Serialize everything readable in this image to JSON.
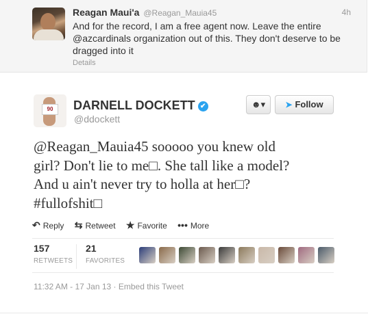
{
  "parent_tweet": {
    "name": "Reagan Maui'a",
    "handle": "@Reagan_Mauia45",
    "time": "4h",
    "text": "And for the record, I am a free agent now. Leave the entire @azcardinals organization out of this. They don't deserve to be dragged into it",
    "details": "Details"
  },
  "main_tweet": {
    "name": "DARNELL DOCKETT",
    "handle": "@ddockett",
    "verified_mark": "✔",
    "jersey_number": "90",
    "user_menu_label": "▾",
    "follow_label": "Follow",
    "text_lines": [
      "@Reagan_Mauia45 sooooo you knew old",
      "girl? Don't lie to me□. She tall like a model?",
      "And u ain't never try to holla at her□?",
      "#fullofshit□"
    ],
    "actions": {
      "reply": "Reply",
      "retweet": "Retweet",
      "favorite": "Favorite",
      "more": "More"
    },
    "stats": {
      "retweets_count": "157",
      "retweets_label": "RETWEETS",
      "favorites_count": "21",
      "favorites_label": "FAVORITES"
    },
    "favoriter_avatar_colors": [
      "#2c3e7a",
      "#8a6a4a",
      "#3d4a35",
      "#6b5a4e",
      "#3a3a3a",
      "#8c7a5c",
      "#c9b8a8",
      "#6a4a3a",
      "#a06a80",
      "#4a5a6a"
    ],
    "footer": "11:32 AM - 17 Jan 13 · Embed this Tweet"
  },
  "colors": {
    "accent": "#2aa3ef",
    "panel": "#f5f5f5",
    "muted": "#999999"
  }
}
